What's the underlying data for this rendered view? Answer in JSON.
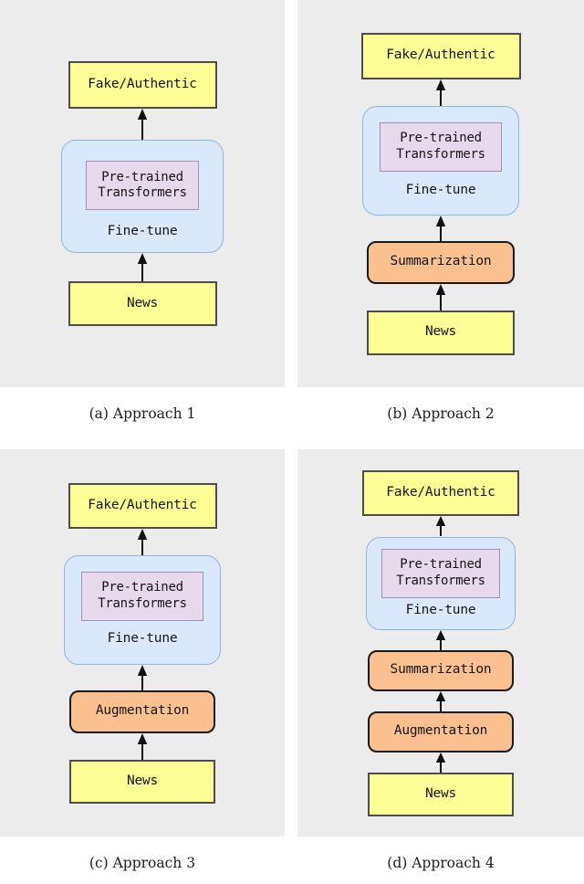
{
  "figure": {
    "background_color": "#ececec",
    "page_background": "#ffffff",
    "colors": {
      "yellow_node": "#fdfd96",
      "orange_node": "#fac090",
      "blue_group": "#d9e8fb",
      "purple_node": "#e6d9ec",
      "panel_background": "#ececec",
      "node_border": "#4d4d4d",
      "arrow": "#111111"
    },
    "panels": [
      {
        "id": "a",
        "caption": "(a) Approach 1",
        "nodes": {
          "input": "News",
          "group_label": "Fine-tune",
          "group_inner_line1": "Pre-trained",
          "group_inner_line2": "Transformers",
          "output": "Fake/Authentic"
        },
        "pipeline": [
          "News",
          "Fine-tune",
          "Fake/Authentic"
        ]
      },
      {
        "id": "b",
        "caption": "(b) Approach 2",
        "nodes": {
          "input": "News",
          "stage1": "Summarization",
          "group_label": "Fine-tune",
          "group_inner_line1": "Pre-trained",
          "group_inner_line2": "Transformers",
          "output": "Fake/Authentic"
        },
        "pipeline": [
          "News",
          "Summarization",
          "Fine-tune",
          "Fake/Authentic"
        ]
      },
      {
        "id": "c",
        "caption": "(c) Approach 3",
        "nodes": {
          "input": "News",
          "stage1": "Augmentation",
          "group_label": "Fine-tune",
          "group_inner_line1": "Pre-trained",
          "group_inner_line2": "Transformers",
          "output": "Fake/Authentic"
        },
        "pipeline": [
          "News",
          "Augmentation",
          "Fine-tune",
          "Fake/Authentic"
        ]
      },
      {
        "id": "d",
        "caption": "(d) Approach 4",
        "nodes": {
          "input": "News",
          "stage1": "Augmentation",
          "stage2": "Summarization",
          "group_label": "Fine-tune",
          "group_inner_line1": "Pre-trained",
          "group_inner_line2": "Transformers",
          "output": "Fake/Authentic"
        },
        "pipeline": [
          "News",
          "Augmentation",
          "Summarization",
          "Fine-tune",
          "Fake/Authentic"
        ]
      }
    ]
  }
}
